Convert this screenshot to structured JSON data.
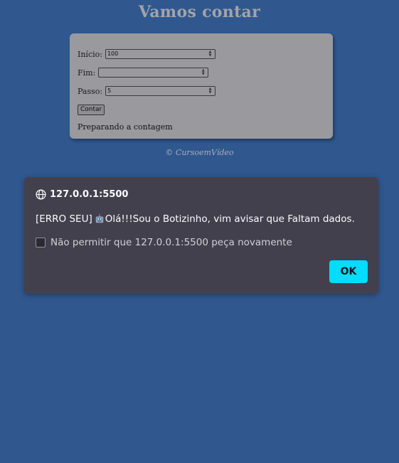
{
  "page": {
    "title": "Vamos contar",
    "footer": "© CursoemVídeo"
  },
  "form": {
    "inicio_label": "Início:",
    "inicio_value": "100",
    "fim_label": "Fim:",
    "fim_value": "",
    "passo_label": "Passo:",
    "passo_value": "5",
    "button_label": "Contar",
    "status_text": "Preparando a contagem"
  },
  "dialog": {
    "origin": "127.0.0.1:5500",
    "message_prefix": "[ERRO SEU]",
    "message_suffix": "Olá!!!Sou o Botizinho, vim avisar que Faltam dados.",
    "checkbox_label": "Não permitir que 127.0.0.1:5500 peça novamente",
    "checkbox_checked": false,
    "ok_label": "OK",
    "icons": {
      "origin": "globe-icon",
      "inline": "robot-icon"
    }
  },
  "colors": {
    "background": "#30588f",
    "card": "#9a9a9e",
    "dialog": "#43404d",
    "ok_button": "#00ddff"
  }
}
